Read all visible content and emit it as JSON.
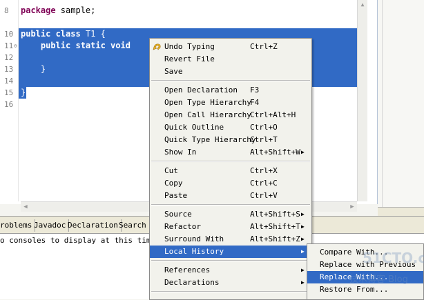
{
  "editor": {
    "line_numbers": [
      "8",
      "10",
      "11",
      "12",
      "13",
      "14",
      "15",
      "16"
    ],
    "code_lines": [
      {
        "pre": "",
        "kw": "package",
        "post": " sample;"
      },
      {
        "pre": "",
        "kw": "public class",
        "post": " T1 {"
      },
      {
        "pre": "    ",
        "kw": "public static void",
        "post": ""
      },
      {
        "pre": "",
        "kw": "",
        "post": ""
      },
      {
        "pre": "    }",
        "kw": "",
        "post": ""
      },
      {
        "pre": "",
        "kw": "",
        "post": ""
      },
      {
        "pre": "}",
        "kw": "",
        "post": ""
      },
      {
        "pre": "",
        "kw": "",
        "post": ""
      }
    ]
  },
  "bottom_view": {
    "tabs": [
      "roblems",
      "Javadoc",
      "Declaration",
      "Search"
    ],
    "message": "o consoles to display at this time."
  },
  "context_menu": {
    "items": [
      {
        "label": "Undo Typing",
        "accel": "Ctrl+Z",
        "submenu": false,
        "icon": "undo-icon"
      },
      {
        "label": "Revert File",
        "accel": "",
        "submenu": false
      },
      {
        "label": "Save",
        "accel": "",
        "submenu": false
      },
      {
        "label": "Open Declaration",
        "accel": "F3",
        "submenu": false
      },
      {
        "label": "Open Type Hierarchy",
        "accel": "F4",
        "submenu": false
      },
      {
        "label": "Open Call Hierarchy",
        "accel": "Ctrl+Alt+H",
        "submenu": false
      },
      {
        "label": "Quick Outline",
        "accel": "Ctrl+O",
        "submenu": false
      },
      {
        "label": "Quick Type Hierarchy",
        "accel": "Ctrl+T",
        "submenu": false
      },
      {
        "label": "Show In",
        "accel": "Alt+Shift+W",
        "submenu": true
      },
      {
        "label": "Cut",
        "accel": "Ctrl+X",
        "submenu": false
      },
      {
        "label": "Copy",
        "accel": "Ctrl+C",
        "submenu": false
      },
      {
        "label": "Paste",
        "accel": "Ctrl+V",
        "submenu": false
      },
      {
        "label": "Source",
        "accel": "Alt+Shift+S",
        "submenu": true
      },
      {
        "label": "Refactor",
        "accel": "Alt+Shift+T",
        "submenu": true
      },
      {
        "label": "Surround With",
        "accel": "Alt+Shift+Z",
        "submenu": true
      },
      {
        "label": "Local History",
        "accel": "",
        "submenu": true,
        "highlighted": true
      },
      {
        "label": "References",
        "accel": "",
        "submenu": true
      },
      {
        "label": "Declarations",
        "accel": "",
        "submenu": true
      }
    ]
  },
  "submenu": {
    "items": [
      {
        "label": "Compare With..."
      },
      {
        "label": "Replace with Previous"
      },
      {
        "label": "Replace With...",
        "highlighted": true
      },
      {
        "label": "Restore From..."
      }
    ]
  },
  "watermark": {
    "line1": "51CTO.com",
    "line2": "技术博客  Blog"
  },
  "colors": {
    "selection": "#316ac5",
    "keyword": "#7f0055",
    "menu_bg": "#f2f2ec"
  }
}
